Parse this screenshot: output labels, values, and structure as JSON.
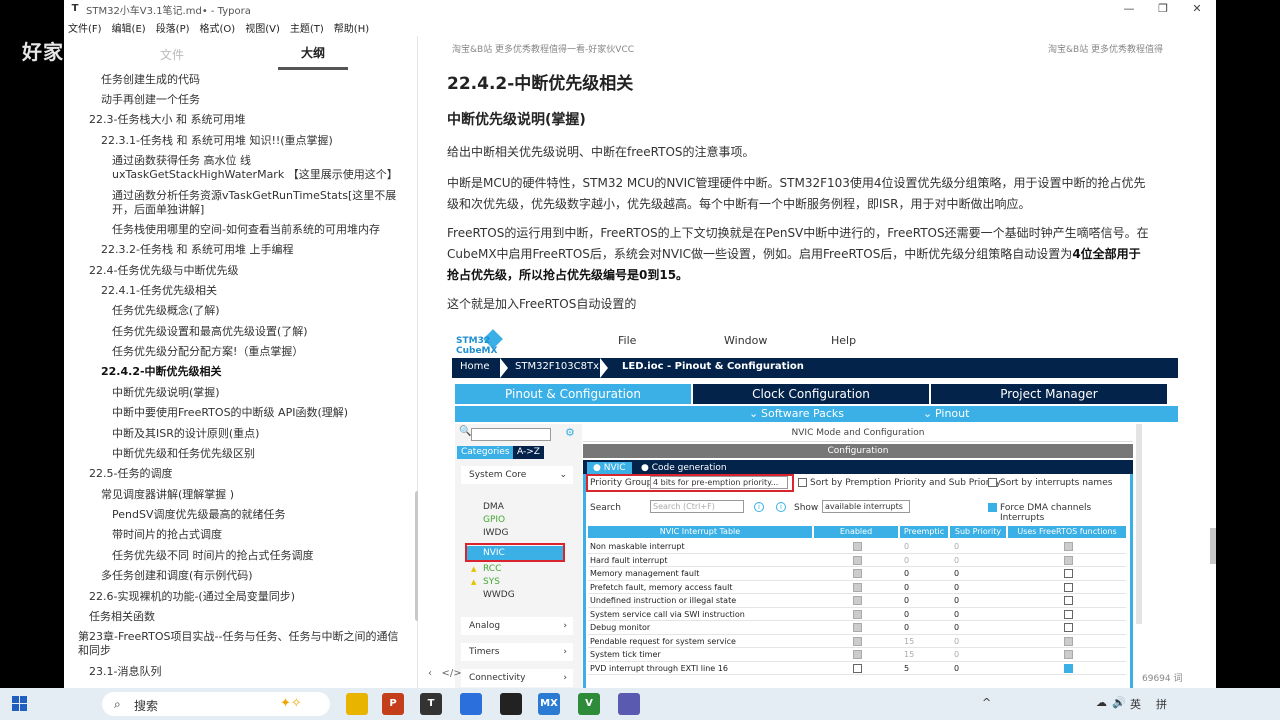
{
  "window": {
    "app_icon": "T",
    "title": "STM32小车V3.1笔记.md• - Typora",
    "controls": {
      "minimize": "—",
      "maximize": "❐",
      "close": "✕"
    }
  },
  "menubar": [
    "文件(F)",
    "编辑(E)",
    "段落(P)",
    "格式(O)",
    "视图(V)",
    "主题(T)",
    "帮助(H)"
  ],
  "watermark": "好家伙VCC",
  "sidebar": {
    "tab_files": "文件",
    "tab_outline": "大纲",
    "outline": [
      "任务创建生成的代码",
      "动手再创建一个任务",
      "22.3-任务栈大小 和 系统可用堆",
      "22.3.1-任务栈 和 系统可用堆 知识!!(重点掌握)",
      "通过函数获得任务 高水位 线",
      "uxTaskGetStackHighWaterMark 【这里展示使用这个】",
      "通过函数分析任务资源vTaskGetRunTimeStats[这里不展",
      "开，后面单独讲解]",
      "任务栈使用哪里的空间-如何查看当前系统的可用堆内存",
      "22.3.2-任务栈 和 系统可用堆 上手编程",
      "22.4-任务优先级与中断优先级",
      "22.4.1-任务优先级相关",
      "任务优先级概念(了解)",
      "任务优先级设置和最高优先级设置(了解)",
      "任务优先级分配分配方案!（重点掌握）",
      "22.4.2-中断优先级相关",
      "中断优先级说明(掌握)",
      "中断中要使用FreeRTOS的中断级 API函数(理解)",
      "中断及其ISR的设计原则(重点)",
      "中断优先级和任务优先级区别",
      "22.5-任务的调度",
      "常见调度器讲解(理解掌握 )",
      "PendSV调度优先级最高的就绪任务",
      "带时间片的抢占式调度",
      "任务优先级不同 时间片的抢占式任务调度",
      "多任务创建和调度(有示例代码)",
      "22.6-实现裸机的功能-(通过全局变量同步)",
      "任务相关函数",
      "第23章-FreeRTOS项目实战--任务与任务、任务与中断之间的通信",
      "和同步",
      "23.1-消息队列"
    ]
  },
  "content": {
    "header_left": "淘宝&B站   更多优秀教程值得一看-好家伙VCC",
    "header_right": "淘宝&B站   更多优秀教程值得",
    "h3": "22.4.2-中断优先级相关",
    "h4": "中断优先级说明(掌握)",
    "p1": "给出中断相关优先级说明、中断在freeRTOS的注意事项。",
    "p2_a": "中断是MCU的硬件特性，STM32 MCU的NVIC管理硬件中断。STM32F103使用4位设置优先级分组策略，用于设置中断的抢占优先",
    "p2_b": "级和次优先级，优先级数字越小，优先级越高。每个中断有一个中断服务例程，即ISR，用于对中断做出响应。",
    "p3_a": "FreeRTOS的运行用到中断，FreeRTOS的上下文切换就是在PenSV中断中进行的，FreeRTOS还需要一个基础时钟产生嘀嗒信号。在",
    "p3_b": "CubeMX中启用FreeRTOS后，系统会对NVIC做一些设置，例如。启用FreeRTOS后，中断优先级分组策略自动设置为",
    "p3_bold1": "4位全部用于",
    "p3_bold2": "抢占优先级，所以抢占优先级编号是0到15。",
    "p4": "这个就是加入FreeRTOS自动设置的",
    "word_count": "69694 词"
  },
  "cubemx": {
    "logo_top": "STM32",
    "logo_bottom": "CubeMX",
    "menu": [
      "File",
      "Window",
      "Help"
    ],
    "breadcrumb": [
      "Home",
      "STM32F103C8Tx",
      "LED.ioc - Pinout & Configuration"
    ],
    "tabs": [
      "Pinout & Configuration",
      "Clock Configuration",
      "Project Manager"
    ],
    "subbar": [
      "Software Packs",
      "Pinout"
    ],
    "cat_tabs": [
      "Categories",
      "A->Z"
    ],
    "groups": [
      "System Core",
      "Analog",
      "Timers",
      "Connectivity"
    ],
    "peripherals": [
      "DMA",
      "GPIO",
      "IWDG",
      "NVIC",
      "RCC",
      "SYS",
      "WWDG"
    ],
    "main_title": "NVIC Mode and Configuration",
    "config_label": "Configuration",
    "mode_tabs": [
      "NVIC",
      "Code generation"
    ],
    "priority_group_label": "Priority Group",
    "priority_group_value": "4 bits for pre-emption priority...",
    "sort_priority": "Sort by Premption Priority and Sub Priority",
    "sort_interrupts": "Sort by interrupts names",
    "search_label": "Search",
    "search_placeholder": "Search (Ctrl+F)",
    "show_label": "Show",
    "show_value": "available interrupts",
    "force_dma": "Force DMA channels Interrupts",
    "table_headers": [
      "NVIC Interrupt Table",
      "Enabled",
      "Preemptic",
      "Sub Priority",
      "Uses FreeRTOS functions"
    ],
    "rows": [
      {
        "name": "Non maskable interrupt",
        "pre": "0",
        "sub": "0",
        "enabled": "on-gray",
        "rtos": "gray",
        "dim": true
      },
      {
        "name": "Hard fault interrupt",
        "pre": "0",
        "sub": "0",
        "enabled": "on-gray",
        "rtos": "gray",
        "dim": true
      },
      {
        "name": "Memory management fault",
        "pre": "0",
        "sub": "0",
        "enabled": "on-gray",
        "rtos": "off",
        "dim": false
      },
      {
        "name": "Prefetch fault, memory access fault",
        "pre": "0",
        "sub": "0",
        "enabled": "on-gray",
        "rtos": "off",
        "dim": false
      },
      {
        "name": "Undefined instruction or illegal state",
        "pre": "0",
        "sub": "0",
        "enabled": "on-gray",
        "rtos": "off",
        "dim": false
      },
      {
        "name": "System service call via SWI instruction",
        "pre": "0",
        "sub": "0",
        "enabled": "on-gray",
        "rtos": "off",
        "dim": false
      },
      {
        "name": "Debug monitor",
        "pre": "0",
        "sub": "0",
        "enabled": "on-gray",
        "rtos": "off",
        "dim": false
      },
      {
        "name": "Pendable request for system service",
        "pre": "15",
        "sub": "0",
        "enabled": "on-gray",
        "rtos": "on-gray",
        "dim": true
      },
      {
        "name": "System tick timer",
        "pre": "15",
        "sub": "0",
        "enabled": "on-gray",
        "rtos": "on-gray",
        "dim": true
      },
      {
        "name": "PVD interrupt through EXTI line 16",
        "pre": "5",
        "sub": "0",
        "enabled": "off",
        "rtos": "on",
        "dim": false
      }
    ]
  },
  "taskbar": {
    "search_label": "搜索",
    "apps": [
      "explorer",
      "powerpoint",
      "typora",
      "pictures",
      "obs",
      "cubemx",
      "vim",
      "files"
    ],
    "app_labels": [
      "",
      "P",
      "T",
      "",
      "",
      "MX",
      "V",
      ""
    ],
    "app_colors": [
      "#e8b400",
      "#c43e1c",
      "#333333",
      "#2a6fdb",
      "#222222",
      "#2b7bd3",
      "#2e8b3a",
      "#5a5ab0"
    ],
    "tray": [
      "^",
      "☁",
      "🔊",
      "英",
      "拼"
    ]
  }
}
